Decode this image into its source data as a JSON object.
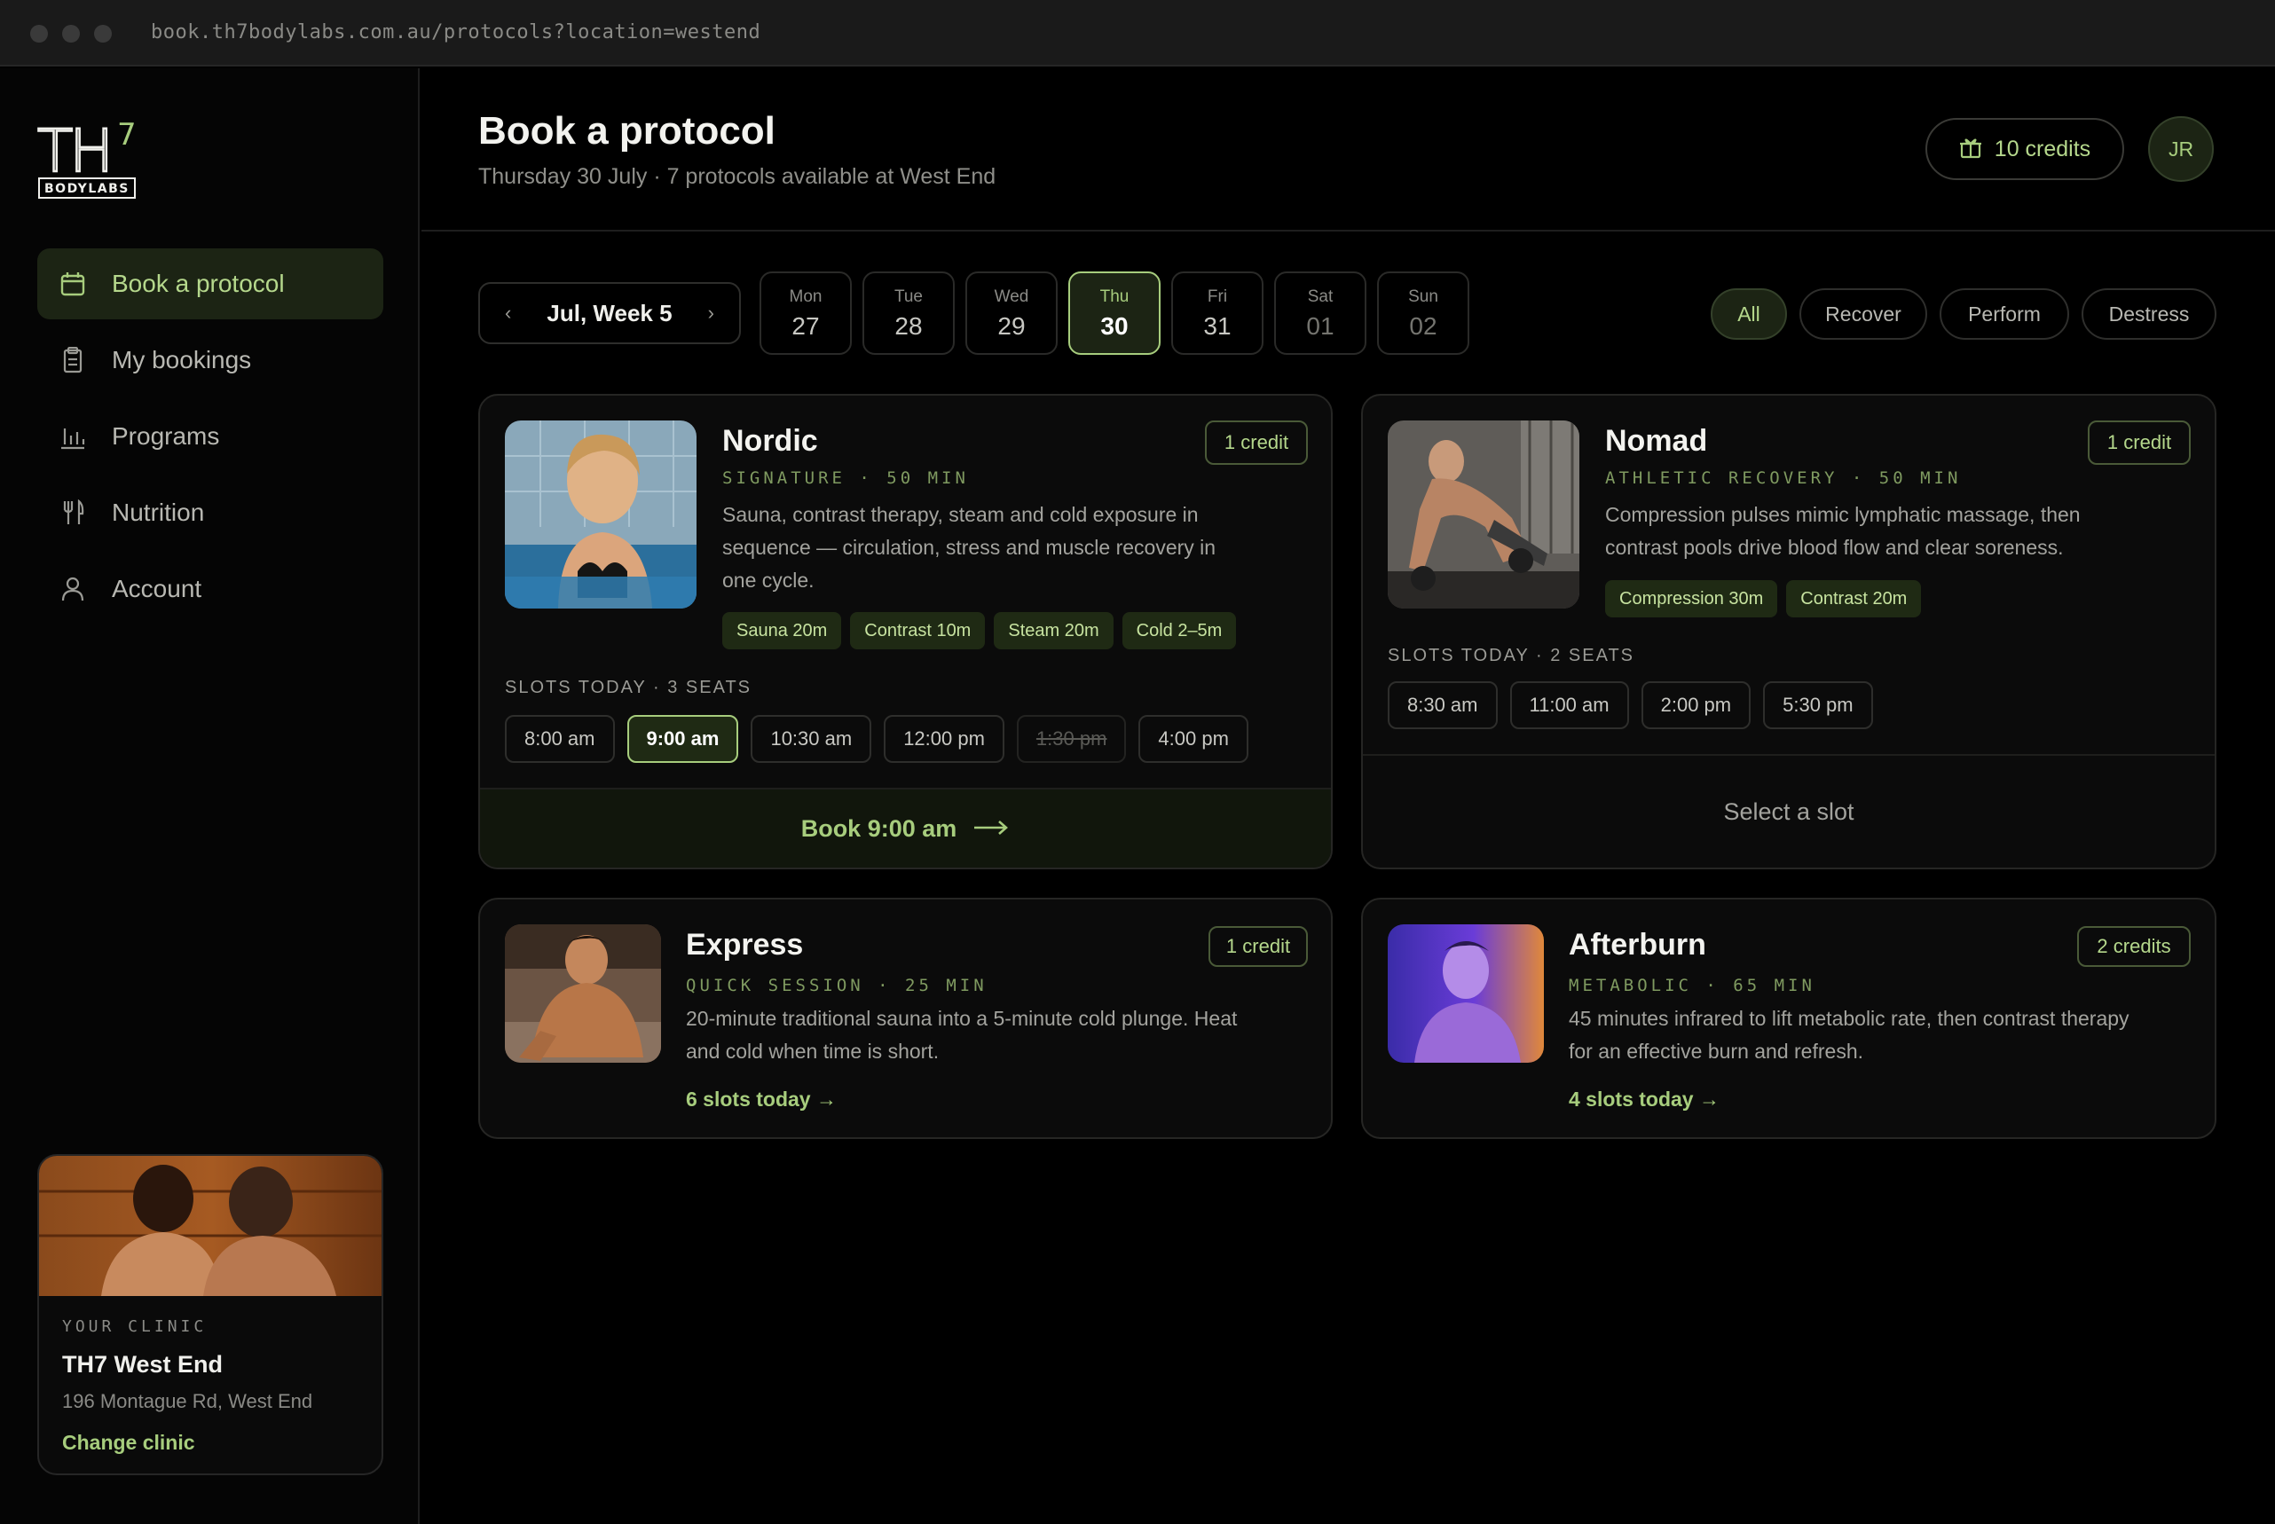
{
  "browser": {
    "url": "book.th7bodylabs.com.au/protocols?location=westend"
  },
  "brand": {
    "logo_main": "TH",
    "logo_sup": "7",
    "logo_sub": "BODYLABS"
  },
  "sidebar": {
    "items": [
      {
        "label": "Book a protocol",
        "icon": "calendar-icon",
        "active": true
      },
      {
        "label": "My bookings",
        "icon": "clipboard-icon"
      },
      {
        "label": "Programs",
        "icon": "bar-chart-icon"
      },
      {
        "label": "Nutrition",
        "icon": "cutlery-icon"
      },
      {
        "label": "Account",
        "icon": "user-icon"
      }
    ],
    "clinic": {
      "eyebrow": "YOUR CLINIC",
      "name": "TH7 West End",
      "address": "196 Montague Rd, West End",
      "change_label": "Change clinic"
    }
  },
  "header": {
    "title": "Book a protocol",
    "subtitle": "Thursday 30 July · 7 protocols available at West End",
    "credits": "10 credits",
    "avatar_initials": "JR"
  },
  "week": {
    "label": "Jul, Week 5",
    "prev": "‹",
    "next": "›",
    "days": [
      {
        "name": "Mon",
        "num": "27"
      },
      {
        "name": "Tue",
        "num": "28"
      },
      {
        "name": "Wed",
        "num": "29"
      },
      {
        "name": "Thu",
        "num": "30",
        "active": true
      },
      {
        "name": "Fri",
        "num": "31"
      },
      {
        "name": "Sat",
        "num": "01"
      },
      {
        "name": "Sun",
        "num": "02"
      }
    ]
  },
  "filters": [
    "All",
    "Recover",
    "Perform",
    "Destress"
  ],
  "protocols": {
    "nordic": {
      "title": "Nordic",
      "eyebrow": "SIGNATURE · 50 MIN",
      "credit": "1 credit",
      "desc1": "Sauna, contrast therapy, steam and cold exposure in",
      "desc2": "sequence — circulation, stress and muscle recovery in",
      "desc3": "one cycle.",
      "tags": [
        "Sauna 20m",
        "Contrast 10m",
        "Steam 20m",
        "Cold 2–5m"
      ],
      "slots_label": "SLOTS TODAY · 3 SEATS",
      "slots": [
        "8:00 am",
        "9:00 am",
        "10:30 am",
        "12:00 pm",
        "1:30 pm",
        "4:00 pm"
      ],
      "cta": "Book 9:00 am"
    },
    "nomad": {
      "title": "Nomad",
      "eyebrow": "ATHLETIC RECOVERY · 50 MIN",
      "credit": "1 credit",
      "desc1": "Compression pulses mimic lymphatic massage, then",
      "desc2": "contrast pools drive blood flow and clear soreness.",
      "tags": [
        "Compression 30m",
        "Contrast 20m"
      ],
      "slots_label": "SLOTS TODAY · 2 SEATS",
      "slots": [
        "8:30 am",
        "11:00 am",
        "2:00 pm",
        "5:30 pm"
      ],
      "cta": "Select a slot"
    },
    "express": {
      "title": "Express",
      "eyebrow": "QUICK SESSION · 25 MIN",
      "credit": "1 credit",
      "desc1": "20-minute traditional sauna into a 5-minute cold plunge. Heat",
      "desc2": "and cold when time is short.",
      "link": "6 slots today →"
    },
    "afterburn": {
      "title": "Afterburn",
      "eyebrow": "METABOLIC · 65 MIN",
      "credit": "2 credits",
      "desc1": "45 minutes infrared to lift metabolic rate, then contrast therapy",
      "desc2": "for an effective burn and refresh.",
      "link": "4 slots today →"
    }
  },
  "colors": {
    "accent": "#a7cd7d",
    "accent_bg": "#1c2414",
    "background": "#000000"
  }
}
